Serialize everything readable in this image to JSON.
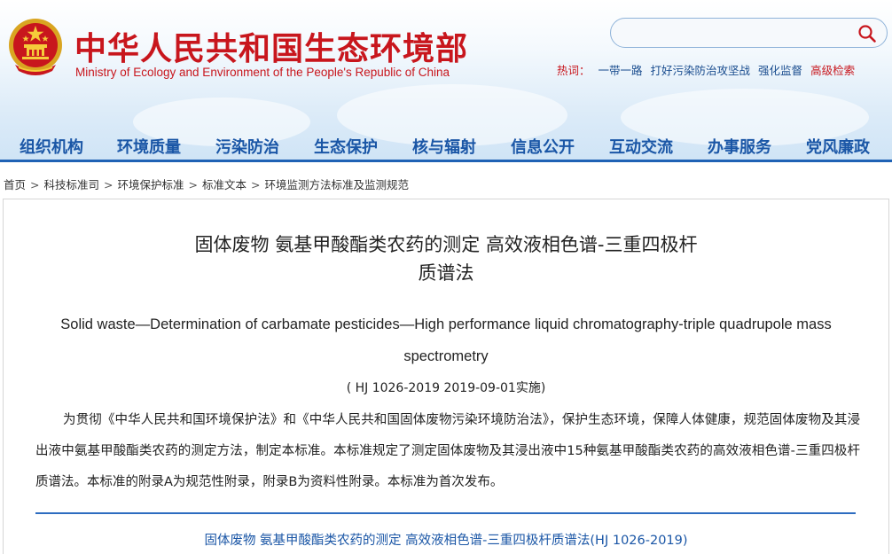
{
  "site": {
    "title_cn": "中华人民共和国生态环境部",
    "title_en": "Ministry of Ecology and Environment of the People's Republic of China",
    "brand_color": "#c8161d",
    "emblem_icon": "national-emblem-icon"
  },
  "search": {
    "value": "",
    "placeholder": "",
    "icon": "search-icon"
  },
  "hotwords": {
    "label": "热词：",
    "items": [
      "一带一路",
      "打好污染防治攻坚战",
      "强化监督"
    ],
    "advanced": "高级检索"
  },
  "nav": {
    "items": [
      "组织机构",
      "环境质量",
      "污染防治",
      "生态保护",
      "核与辐射",
      "信息公开",
      "互动交流",
      "办事服务",
      "党风廉政"
    ],
    "color": "#1a56a6"
  },
  "breadcrumb": {
    "items": [
      "首页",
      "科技标准司",
      "环境保护标准",
      "标准文本",
      "环境监测方法标准及监测规范"
    ],
    "separator": ">"
  },
  "document": {
    "title_line1": "固体废物 氨基甲酸酯类农药的测定 高效液相色谱-三重四极杆",
    "title_line2": "质谱法",
    "title_en": "Solid waste—Determination of carbamate pesticides—High performance liquid chromatography-triple quadrupole mass spectrometry",
    "code": "( HJ 1026-2019 2019-09-01实施)",
    "body": "为贯彻《中华人民共和国环境保护法》和《中华人民共和国固体废物污染环境防治法》，保护生态环境，保障人体健康，规范固体废物及其浸出液中氨基甲酸酯类农药的测定方法，制定本标准。本标准规定了测定固体废物及其浸出液中15种氨基甲酸酯类农药的高效液相色谱-三重四极杆质谱法。本标准的附录A为规范性附录，附录B为资料性附录。本标准为首次发布。",
    "attachment": "固体废物 氨基甲酸酯类农药的测定 高效液相色谱-三重四极杆质谱法(HJ 1026-2019)",
    "link_color": "#1a56a6"
  }
}
